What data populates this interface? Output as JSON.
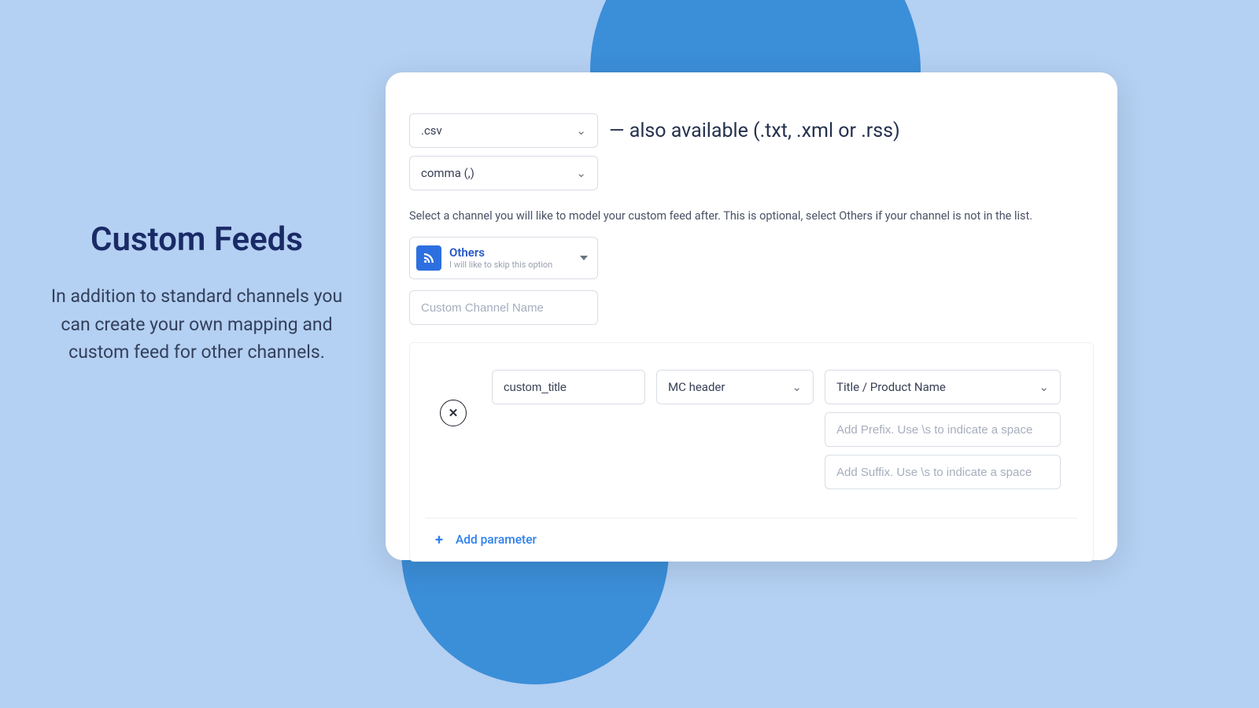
{
  "left": {
    "title": "Custom Feeds",
    "description": "In addition to standard channels you can create your own mapping and custom feed for other channels."
  },
  "form": {
    "format_select": ".csv",
    "available_note": "— also available (.txt, .xml or .rss)",
    "separator_select": "comma (,)",
    "channel_helper": "Select a channel you will like to model your custom feed after. This is optional, select Others if your channel is not in the list.",
    "channel": {
      "title": "Others",
      "subtitle": "I will like to skip this option"
    },
    "custom_name_placeholder": "Custom Channel Name",
    "mapping": {
      "custom_header_value": "custom_title",
      "mc_header_label": "MC header",
      "field_label": "Title / Product Name",
      "prefix_placeholder": "Add Prefix. Use \\s to indicate a space",
      "suffix_placeholder": "Add Suffix. Use \\s to indicate a space",
      "delete_symbol": "✕"
    },
    "add_parameter_label": "Add parameter",
    "plus_symbol": "+"
  }
}
